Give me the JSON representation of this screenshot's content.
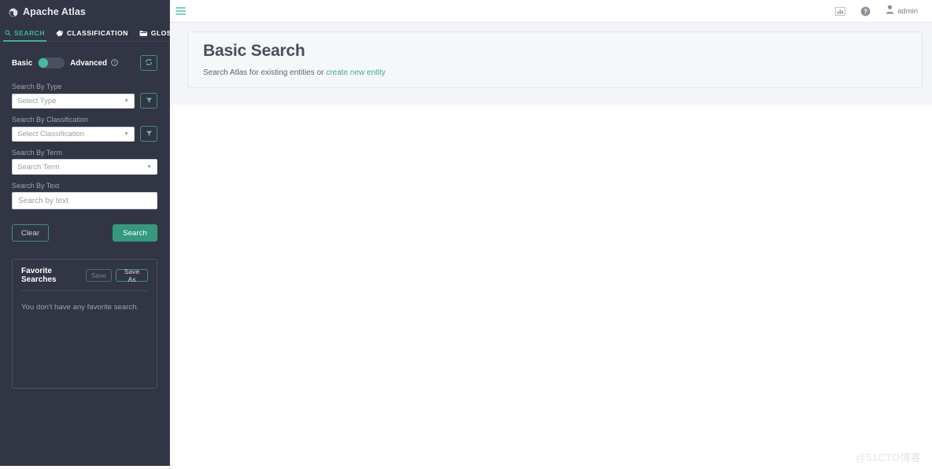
{
  "brand": {
    "title": "Apache Atlas",
    "icon": "globe-icon"
  },
  "sidebar": {
    "tabs": [
      {
        "label": "SEARCH",
        "icon": "search-icon",
        "active": true
      },
      {
        "label": "CLASSIFICATION",
        "icon": "tag-icon",
        "active": false
      },
      {
        "label": "GLOSSARY",
        "icon": "folder-icon",
        "active": false
      }
    ],
    "mode": {
      "basic_label": "Basic",
      "advanced_label": "Advanced",
      "selected": "Basic",
      "help_icon": "question-circle-icon",
      "refresh_icon": "refresh-icon"
    },
    "fields": [
      {
        "label": "Search By Type",
        "placeholder": "Select Type",
        "value": "",
        "control": "select",
        "has_filter": true,
        "filter_icon": "funnel-icon"
      },
      {
        "label": "Search By Classification",
        "placeholder": "Select Classification",
        "value": "",
        "control": "select",
        "has_filter": true,
        "filter_icon": "funnel-icon"
      },
      {
        "label": "Search By Term",
        "placeholder": "Search Term",
        "value": "",
        "control": "select",
        "has_filter": false
      },
      {
        "label": "Search By Text",
        "placeholder": "Search by text",
        "value": "",
        "control": "text",
        "has_filter": false
      }
    ],
    "actions": {
      "clear_label": "Clear",
      "search_label": "Search"
    },
    "favorites": {
      "title": "Favorite Searches",
      "save_label": "Save",
      "save_as_label": "Save As",
      "empty_text": "You don't have any favorite search."
    }
  },
  "topbar": {
    "menu_icon": "hamburger-icon",
    "stats_icon": "bar-chart-icon",
    "help_icon": "question-circle-icon",
    "user_icon": "user-icon",
    "user_name": "admin"
  },
  "main": {
    "title": "Basic Search",
    "subtitle_prefix": "Search Atlas for existing entities or ",
    "link_label": "create new entity"
  },
  "watermark": {
    "text": "@51CTO博客"
  },
  "colors": {
    "sidebar_bg": "#323544",
    "accent": "#38b49a",
    "button_green": "#35997f",
    "link_green": "#3bb08f",
    "main_bg": "#f4f5f8",
    "hero_bg": "#f6f7f9"
  }
}
